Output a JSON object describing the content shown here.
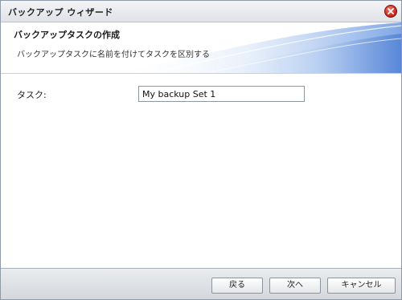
{
  "window": {
    "title": "バックアップ ウィザード"
  },
  "header": {
    "title": "バックアップタスクの作成",
    "description": "バックアップタスクに名前を付けてタスクを区別する"
  },
  "form": {
    "task_label": "タスク:",
    "task_value": "My backup Set 1"
  },
  "footer": {
    "back_label": "戻る",
    "next_label": "次へ",
    "cancel_label": "キャンセル"
  },
  "icons": {
    "close": "close-icon"
  },
  "colors": {
    "close_red": "#c8281b",
    "header_accent": "#5b86d6"
  }
}
